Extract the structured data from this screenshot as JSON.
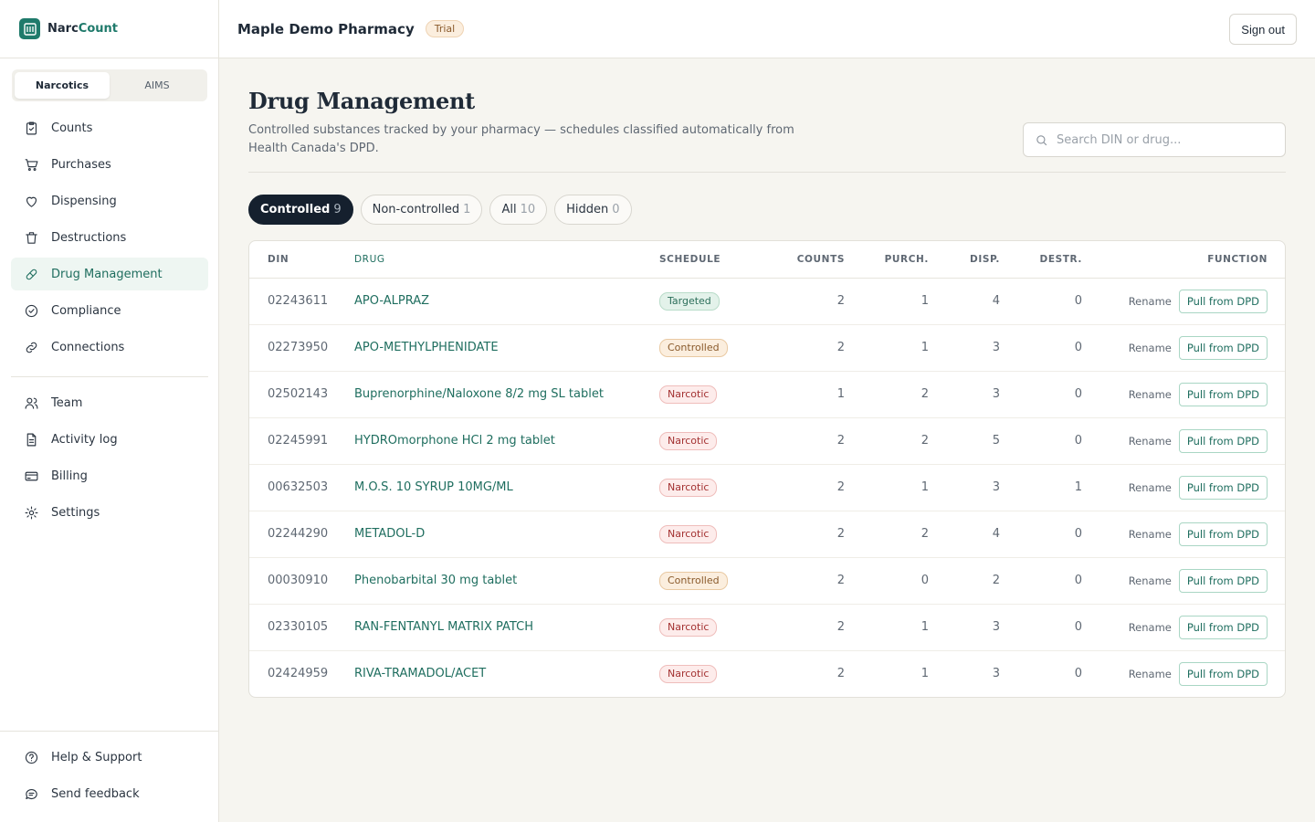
{
  "brand": {
    "name_part1": "Narc",
    "name_part2": "Count"
  },
  "org": {
    "name": "Maple Demo Pharmacy",
    "badge": "Trial"
  },
  "header": {
    "signout_label": "Sign out"
  },
  "sidebar": {
    "segments": [
      {
        "label": "Narcotics",
        "active": true
      },
      {
        "label": "AIMS",
        "active": false
      }
    ],
    "items": [
      {
        "label": "Counts",
        "icon": "clipboard-check-icon"
      },
      {
        "label": "Purchases",
        "icon": "cart-icon"
      },
      {
        "label": "Dispensing",
        "icon": "heart-icon"
      },
      {
        "label": "Destructions",
        "icon": "trash-icon"
      },
      {
        "label": "Drug Management",
        "icon": "pill-icon",
        "active": true
      },
      {
        "label": "Compliance",
        "icon": "check-circle-icon"
      },
      {
        "label": "Connections",
        "icon": "link-icon"
      }
    ],
    "items2": [
      {
        "label": "Team",
        "icon": "users-icon"
      },
      {
        "label": "Activity log",
        "icon": "file-text-icon"
      },
      {
        "label": "Billing",
        "icon": "credit-card-icon"
      },
      {
        "label": "Settings",
        "icon": "gear-icon"
      }
    ],
    "bottom": [
      {
        "label": "Help & Support",
        "icon": "help-circle-icon"
      },
      {
        "label": "Send feedback",
        "icon": "message-icon"
      }
    ]
  },
  "page": {
    "title": "Drug Management",
    "subtitle": "Controlled substances tracked by your pharmacy — schedules classified automatically from Health Canada's DPD.",
    "search_placeholder": "Search DIN or drug..."
  },
  "filters": [
    {
      "label": "Controlled",
      "count": "9",
      "active": true
    },
    {
      "label": "Non-controlled",
      "count": "1",
      "active": false
    },
    {
      "label": "All",
      "count": "10",
      "active": false
    },
    {
      "label": "Hidden",
      "count": "0",
      "active": false
    }
  ],
  "table": {
    "columns": [
      "DIN",
      "DRUG",
      "SCHEDULE",
      "COUNTS",
      "PURCH.",
      "DISP.",
      "DESTR.",
      "FUNCTION"
    ],
    "rename_label": "Rename",
    "pull_label": "Pull from DPD",
    "rows": [
      {
        "din": "02243611",
        "drug": "APO-ALPRAZ",
        "schedule": "Targeted",
        "counts": "2",
        "purch": "1",
        "disp": "4",
        "destr": "0"
      },
      {
        "din": "02273950",
        "drug": "APO-METHYLPHENIDATE",
        "schedule": "Controlled",
        "counts": "2",
        "purch": "1",
        "disp": "3",
        "destr": "0"
      },
      {
        "din": "02502143",
        "drug": "Buprenorphine/Naloxone 8/2 mg SL tablet",
        "schedule": "Narcotic",
        "counts": "1",
        "purch": "2",
        "disp": "3",
        "destr": "0"
      },
      {
        "din": "02245991",
        "drug": "HYDROmorphone HCl 2 mg tablet",
        "schedule": "Narcotic",
        "counts": "2",
        "purch": "2",
        "disp": "5",
        "destr": "0"
      },
      {
        "din": "00632503",
        "drug": "M.O.S. 10 SYRUP 10MG/ML",
        "schedule": "Narcotic",
        "counts": "2",
        "purch": "1",
        "disp": "3",
        "destr": "1"
      },
      {
        "din": "02244290",
        "drug": "METADOL-D",
        "schedule": "Narcotic",
        "counts": "2",
        "purch": "2",
        "disp": "4",
        "destr": "0"
      },
      {
        "din": "00030910",
        "drug": "Phenobarbital 30 mg tablet",
        "schedule": "Controlled",
        "counts": "2",
        "purch": "0",
        "disp": "2",
        "destr": "0"
      },
      {
        "din": "02330105",
        "drug": "RAN-FENTANYL MATRIX PATCH",
        "schedule": "Narcotic",
        "counts": "2",
        "purch": "1",
        "disp": "3",
        "destr": "0"
      },
      {
        "din": "02424959",
        "drug": "RIVA-TRAMADOL/ACET",
        "schedule": "Narcotic",
        "counts": "2",
        "purch": "1",
        "disp": "3",
        "destr": "0"
      }
    ]
  },
  "colors": {
    "accent": "#1f7a6b",
    "dark": "#15202e",
    "narcotic": "#a33131",
    "controlled": "#8a5a2b",
    "targeted": "#2c6e5a"
  }
}
